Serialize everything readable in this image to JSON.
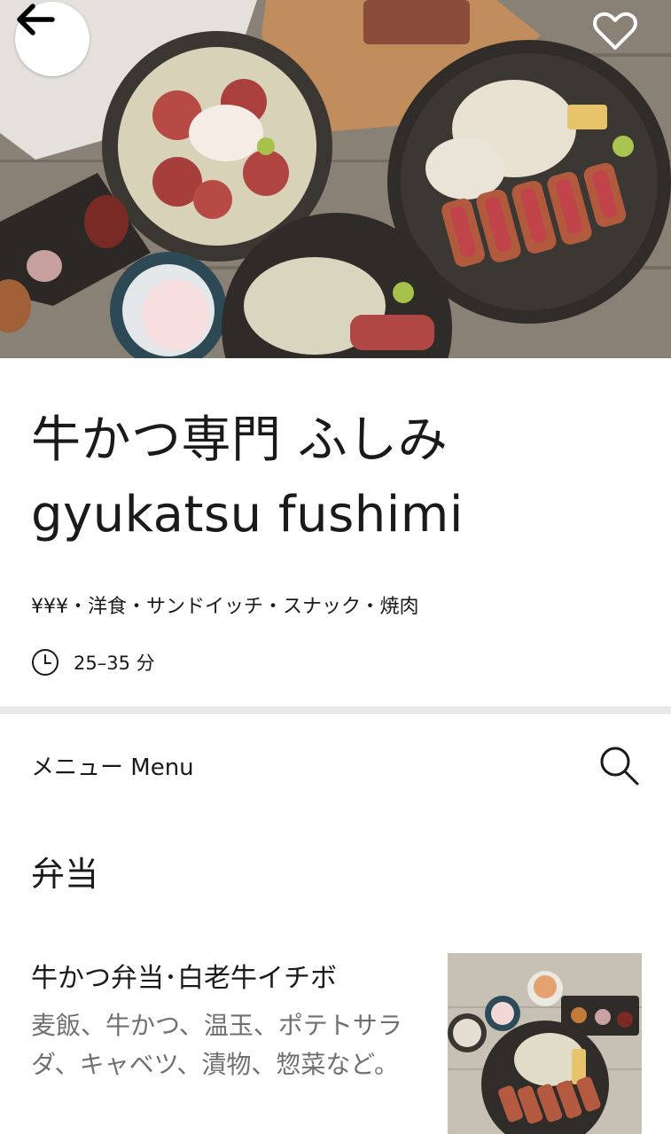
{
  "store": {
    "name_ja": "牛かつ専門 ふしみ",
    "name_en": "gyukatsu fushimi",
    "meta": "¥¥¥・洋食・サンドイッチ・スナック・焼肉",
    "delivery_time": "25–35 分"
  },
  "icons": {
    "back": "arrow-left-icon",
    "favorite": "heart-outline-icon",
    "clock": "clock-icon",
    "search": "search-icon"
  },
  "menu": {
    "header": "メニュー Menu",
    "sections": [
      {
        "title": "弁当",
        "items": [
          {
            "name": "牛かつ弁当･白老牛イチボ",
            "description": "麦飯、牛かつ、温玉、ポテトサラダ、キャベツ、漬物、惣菜など。"
          }
        ]
      }
    ]
  },
  "colors": {
    "text": "#1a1a1a",
    "muted": "#707070",
    "divider": "#e8e8e8"
  }
}
